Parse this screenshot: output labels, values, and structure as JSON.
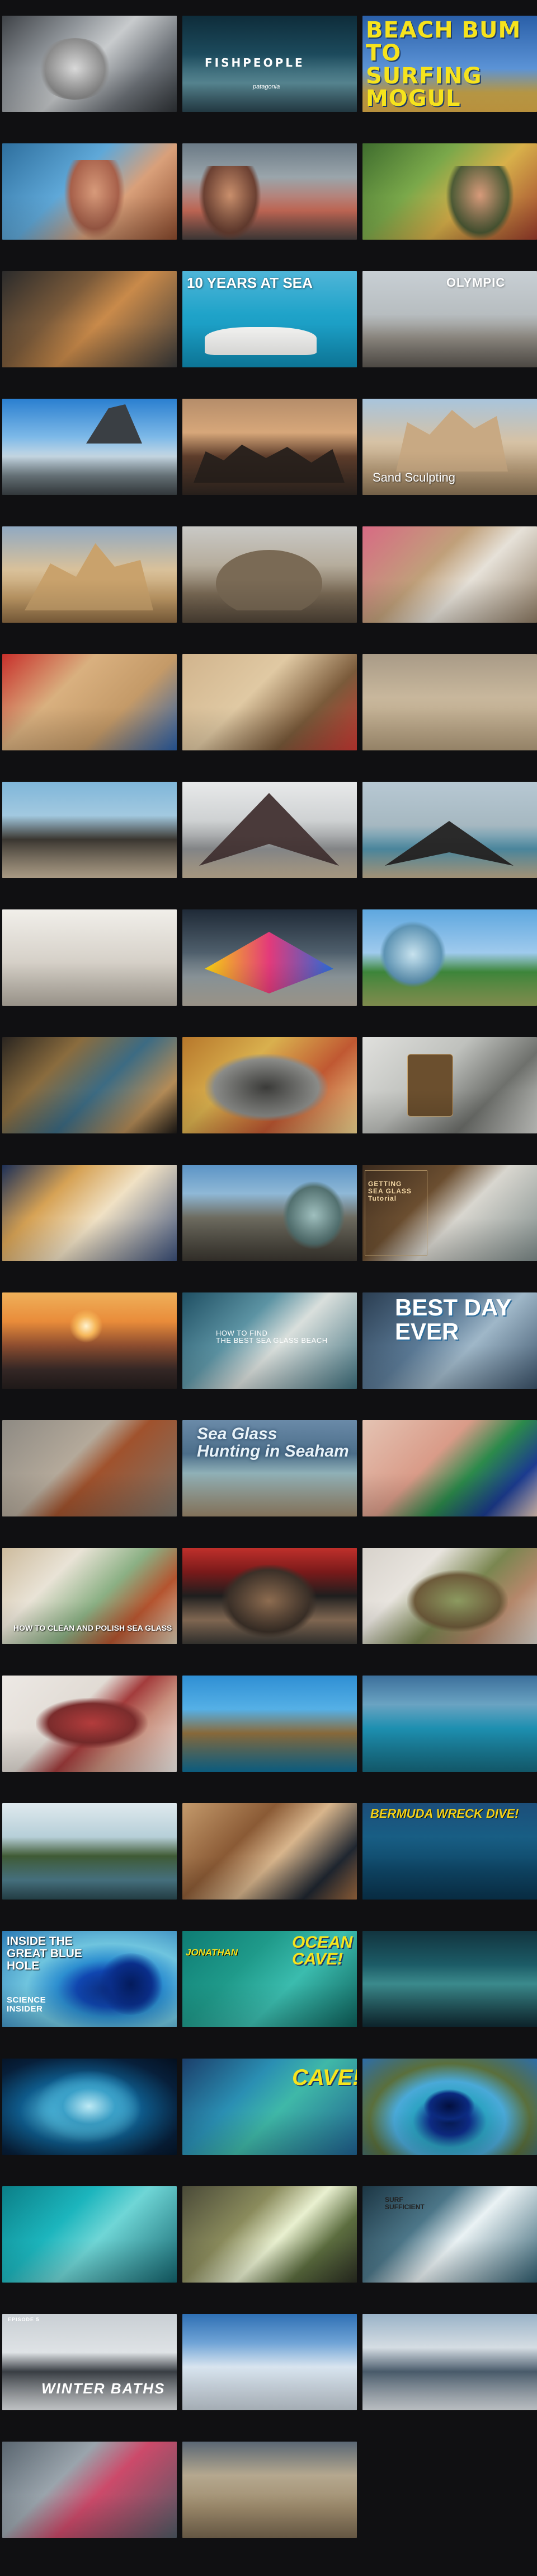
{
  "columns": 3,
  "thumbnails": [
    {
      "label": "",
      "subtext": "",
      "icon": "",
      "bg": "linear-gradient(135deg,#3e4247 0%,#8e9398 30%,#c8cbcd 50%,#6b7076 75%,#2f3337 100%)"
    },
    {
      "label": "FISHPEOPLE",
      "subtext": "patagonia",
      "icon": "",
      "bg": "linear-gradient(180deg,#0e2c3a 0%,#1c4a5c 40%,#5a8b97 70%,#2a4550 100%)"
    },
    {
      "label": "BEACH BUM\nTO\nSURFING MOGUL",
      "subtext": "",
      "icon": "",
      "bg": "linear-gradient(180deg,#2a5fa8 0%,#5b93d6 55%,#c9a64b 80%,#e0b04a 100%)"
    },
    {
      "label": "",
      "subtext": "",
      "icon": "",
      "bg": "linear-gradient(135deg,#2e6f9e 0%,#5fa8d8 40%,#d9a07a 65%,#8a4a2d 100%)"
    },
    {
      "label": "",
      "subtext": "",
      "icon": "",
      "bg": "linear-gradient(180deg,#6b7a86 0%,#9aa5ab 35%,#c76a57 70%,#4a4240 100%)"
    },
    {
      "label": "",
      "subtext": "",
      "icon": "",
      "bg": "linear-gradient(135deg,#3f6d2e 0%,#7aa84a 35%,#d8b04a 60%,#9b3b2b 100%)"
    },
    {
      "label": "",
      "subtext": "",
      "icon": "",
      "bg": "linear-gradient(135deg,#2b2b2b 0%,#7a5a3a 35%,#c98a4a 55%,#3a3a3a 100%)"
    },
    {
      "label": "10 YEARS AT SEA",
      "subtext": "",
      "icon": "",
      "bg": "linear-gradient(180deg,#4fb5d8 0%,#1fa3c9 45%,#0f8db5 100%)"
    },
    {
      "label": "OLYMPIC",
      "subtext": "",
      "icon": "",
      "bg": "linear-gradient(180deg,#c8cfd4 0%,#b7bdc0 45%,#8f8a82 70%,#5d5852 100%)"
    },
    {
      "label": "",
      "subtext": "",
      "icon": "",
      "bg": "linear-gradient(180deg,#2a7fd0 0%,#7db9e8 40%,#c6d8e4 60%,#6f7c82 80%,#3d4347 100%)"
    },
    {
      "label": "",
      "subtext": "",
      "icon": "",
      "bg": "linear-gradient(180deg,#b58d6a 0%,#d7a77a 35%,#5e3d2b 60%,#2f2621 100%)"
    },
    {
      "label": "Sand Sculpting",
      "subtext": "",
      "icon": "",
      "bg": "linear-gradient(180deg,#a8c4dc 0%,#d6c2a5 45%,#b59a77 75%,#8d7657 100%)"
    },
    {
      "label": "",
      "subtext": "",
      "icon": "",
      "bg": "linear-gradient(180deg,#90a9c2 0%,#d9c19a 45%,#c09a66 75%,#8d6b43 100%)"
    },
    {
      "label": "",
      "subtext": "",
      "icon": "",
      "bg": "linear-gradient(180deg,#c9c9c6 0%,#b6ad9d 40%,#7a6a55 70%,#514538 100%)"
    },
    {
      "label": "",
      "subtext": "",
      "icon": "",
      "bg": "linear-gradient(135deg,#d86a84 0%,#c0a07a 40%,#e6e1d8 60%,#8d7a63 100%)"
    },
    {
      "label": "",
      "subtext": "",
      "icon": "",
      "bg": "linear-gradient(135deg,#c8302b 0%,#d9b07f 35%,#c49a68 65%,#2a5fa8 100%)"
    },
    {
      "label": "",
      "subtext": "",
      "icon": "",
      "bg": "linear-gradient(135deg,#d1b48d 0%,#e0c9a3 40%,#7a5a3a 70%,#cc3a34 100%)"
    },
    {
      "label": "",
      "subtext": "",
      "icon": "",
      "bg": "linear-gradient(180deg,#a99b87 0%,#c8b79c 45%,#b49e7d 100%)"
    },
    {
      "label": "",
      "subtext": "",
      "icon": "",
      "bg": "linear-gradient(180deg,#7fb6d9 0%,#a2c9e0 35%,#3b3731 60%,#cdbba0 100%)"
    },
    {
      "label": "",
      "subtext": "",
      "icon": "",
      "bg": "linear-gradient(180deg,#e8e9ea 0%,#cfd2d3 40%,#8a8c8e 70%,#c9b79a 100%)"
    },
    {
      "label": "",
      "subtext": "",
      "icon": "",
      "bg": "linear-gradient(180deg,#b7c8d3 0%,#a6b8c1 45%,#4e8da5 70%,#c4b08f 100%)"
    },
    {
      "label": "",
      "subtext": "",
      "icon": "",
      "bg": "linear-gradient(180deg,#f1efea 0%,#d8d3cb 50%,#b9b2a6 100%)"
    },
    {
      "label": "",
      "subtext": "",
      "icon": "",
      "bg": "linear-gradient(180deg,#1f2a37 0%,#4f5f6c 45%,#8f9a9f 70%,#b9b1a3 100%)"
    },
    {
      "label": "",
      "subtext": "",
      "icon": "",
      "bg": "linear-gradient(180deg,#5ea7df 0%,#9fcaed 45%,#3f8a3c 65%,#9aa95e 100%)"
    },
    {
      "label": "",
      "subtext": "",
      "icon": "",
      "bg": "linear-gradient(135deg,#2a2520 0%,#8a6c3e 30%,#3c6b83 55%,#b38b57 80%,#1d1a17 100%)"
    },
    {
      "label": "",
      "subtext": "",
      "icon": "",
      "bg": "linear-gradient(135deg,#b7772b 0%,#d9b04e 35%,#c05832 65%,#f0d690 100%)"
    },
    {
      "label": "",
      "subtext": "",
      "icon": "",
      "bg": "linear-gradient(135deg,#e0e0dd 0%,#bfc1bd 40%,#6e706c 70%,#d5d6d2 100%)"
    },
    {
      "label": "",
      "subtext": "",
      "icon": "",
      "bg": "linear-gradient(135deg,#1c2f57 0%,#d6a255 30%,#f0e1c4 55%,#3a4f7a 100%)"
    },
    {
      "label": "",
      "subtext": "",
      "icon": "",
      "bg": "linear-gradient(180deg,#5b94c6 0%,#8fb8d6 30%,#6d6b5f 55%,#3b3730 100%)"
    },
    {
      "label": "GETTING\nSEA GLASS\nTutorial",
      "subtext": "",
      "icon": "",
      "bg": "linear-gradient(135deg,#3b2b1e 0%,#6b4e30 35%,#d8d6cf 55%,#7d8a89 100%)"
    },
    {
      "label": "",
      "subtext": "",
      "icon": "",
      "bg": "linear-gradient(180deg,#efb05a 0%,#e98c3a 30%,#8d4d2f 55%,#3a2b29 80%,#251e1d 100%)"
    },
    {
      "label": "HOW TO FIND\nTHE BEST SEA GLASS BEACH",
      "subtext": "",
      "icon": "",
      "bg": "linear-gradient(135deg,#1f4f63 0%,#5c93a3 35%,#d9dfdc 55%,#3e6f7d 100%)"
    },
    {
      "label": "BEST DAY\nEVER",
      "subtext": "",
      "icon": "",
      "bg": "linear-gradient(135deg,#2b3e52 0%,#5b7a96 40%,#9fb7c8 60%,#3b5269 100%)"
    },
    {
      "label": "",
      "subtext": "",
      "icon": "",
      "bg": "linear-gradient(135deg,#8e8a83 0%,#b4a99a 40%,#a0522d 55%,#7c766b 100%)"
    },
    {
      "label": "Sea Glass\nHunting in Seaham",
      "subtext": "",
      "icon": "",
      "bg": "linear-gradient(180deg,#6a8aa8 0%,#4c6e8a 35%,#8fb0b7 55%,#9e8a6d 100%)"
    },
    {
      "label": "",
      "subtext": "",
      "icon": "",
      "bg": "linear-gradient(135deg,#e4c3b3 0%,#d99b88 40%,#2c8a4b 60%,#1b3b8f 80%,#e8cbbd 100%)"
    },
    {
      "label": "HOW TO CLEAN AND POLISH SEA GLASS",
      "subtext": "",
      "icon": "",
      "bg": "linear-gradient(135deg,#cdbb9d 0%,#e9e3d6 30%,#8bb084 55%,#b4542f 75%,#d8cab1 100%)"
    },
    {
      "label": "",
      "subtext": "",
      "icon": "",
      "bg": "linear-gradient(180deg,#c0302b 0%,#7a1a1a 25%,#1e1e1e 50%,#8a6f58 75%,#3c3a36 100%)"
    },
    {
      "label": "",
      "subtext": "",
      "icon": "",
      "bg": "linear-gradient(135deg,#d7d2cb 0%,#e8e4de 30%,#7a8650 55%,#b4876a 75%,#dbd5cc 100%)"
    },
    {
      "label": "",
      "subtext": "",
      "icon": "",
      "bg": "linear-gradient(135deg,#ede9e5 0%,#e1dbd4 40%,#a33c3c 55%,#c88e7c 70%,#efebe7 100%)"
    },
    {
      "label": "",
      "subtext": "",
      "icon": "",
      "bg": "linear-gradient(180deg,#2f8fd4 0%,#55b0e6 35%,#8a6a3a 60%,#0f6f98 100%)"
    },
    {
      "label": "",
      "subtext": "",
      "icon": "",
      "bg": "linear-gradient(180deg,#3c6f9b 0%,#6aa3c2 30%,#1d8fb0 55%,#166a7f 100%)"
    },
    {
      "label": "",
      "subtext": "",
      "icon": "",
      "bg": "linear-gradient(180deg,#dfe9ee 0%,#b6cfd8 35%,#3f5a34 55%,#4c7b8a 80%,#2b4a52 100%)"
    },
    {
      "label": "",
      "subtext": "",
      "icon": "",
      "bg": "linear-gradient(135deg,#c49a6c 0%,#8a5a35 35%,#d8b58c 55%,#1f2630 80%,#a06a3f 100%)"
    },
    {
      "label": "BERMUDA WRECK DIVE!",
      "subtext": "",
      "icon": "",
      "bg": "linear-gradient(180deg,#1c4e7a 0%,#185e84 35%,#0e4565 70%,#0a3550 100%)"
    },
    {
      "label": "INSIDE THE\nGREAT BLUE\nHOLE",
      "subtext": "SCIENCE\nINSIDER",
      "icon": "",
      "bg": "radial-gradient(ellipse at 62% 60%,#0a2a7a 0%,#1046b0 22%,#2d8fd0 35%,#6fc4de 55%,#2b7ab6 100%)"
    },
    {
      "label": "JONATHAN",
      "subtext": "OCEAN\nCAVE!",
      "icon": "",
      "bg": "linear-gradient(135deg,#0e7c74 0%,#1f9a8a 35%,#3bbcae 60%,#0d5f5a 100%)"
    },
    {
      "label": "",
      "subtext": "",
      "icon": "",
      "bg": "linear-gradient(180deg,#12343f 0%,#1c5b66 35%,#3b8a8c 55%,#0f2a33 100%)"
    },
    {
      "label": "",
      "subtext": "",
      "icon": "",
      "bg": "radial-gradient(ellipse at 45% 55%,#a9def0 0%,#4fb6d8 20%,#0e5a8a 45%,#071f3a 75%,#040f1e 100%)"
    },
    {
      "label": "CAVE!",
      "subtext": "",
      "icon": "",
      "bg": "linear-gradient(135deg,#1b3e6a 0%,#2a8fb3 35%,#3fb8a8 55%,#1f5f8f 100%)"
    },
    {
      "label": "",
      "subtext": "",
      "icon": "",
      "bg": "radial-gradient(ellipse at 50% 65%,#051a52 0%,#0e2d8a 16%,#2da3c3 30%,#4aa9d8 45%,#5a6f3c 65%,#2d6da8 100%)"
    },
    {
      "label": "",
      "subtext": "",
      "icon": "",
      "bg": "linear-gradient(135deg,#0b7f87 0%,#1cb5bd 35%,#6fd6d6 55%,#13636d 100%)"
    },
    {
      "label": "",
      "subtext": "",
      "icon": "",
      "bg": "linear-gradient(135deg,#4a4a38 0%,#8a8b5c 35%,#e9f0d0 55%,#5c6d3f 75%,#2a2d22 100%)"
    },
    {
      "label": "SURF\nSUFFICIENT",
      "subtext": "",
      "icon": "",
      "bg": "linear-gradient(135deg,#1c3644 0%,#4c7688 35%,#eaf2f4 55%,#2f5c6e 100%)"
    },
    {
      "label": "WINTER BATHS",
      "subtext": "EPISODE 5",
      "icon": "",
      "bg": "linear-gradient(180deg,#c9cfd4 0%,#dfe3e6 40%,#3a3f45 60%,#e8ebed 100%)"
    },
    {
      "label": "",
      "subtext": "",
      "icon": "",
      "bg": "linear-gradient(180deg,#2e6fb4 0%,#6fa3d6 30%,#d8e4ef 55%,#c8d2db 100%)"
    },
    {
      "label": "",
      "subtext": "",
      "icon": "",
      "bg": "linear-gradient(180deg,#9ab3c8 0%,#d5dde3 35%,#4a5c6c 60%,#e1e6ea 100%)"
    },
    {
      "label": "",
      "subtext": "",
      "icon": "",
      "bg": "linear-gradient(135deg,#5a6670 0%,#9aa4ac 35%,#cc4a6a 55%,#4f5a64 100%)"
    },
    {
      "label": "",
      "subtext": "",
      "icon": "",
      "bg": "linear-gradient(180deg,#5a6774 0%,#b5a88f 35%,#9d8a6b 70%,#7b6a52 100%)"
    }
  ]
}
